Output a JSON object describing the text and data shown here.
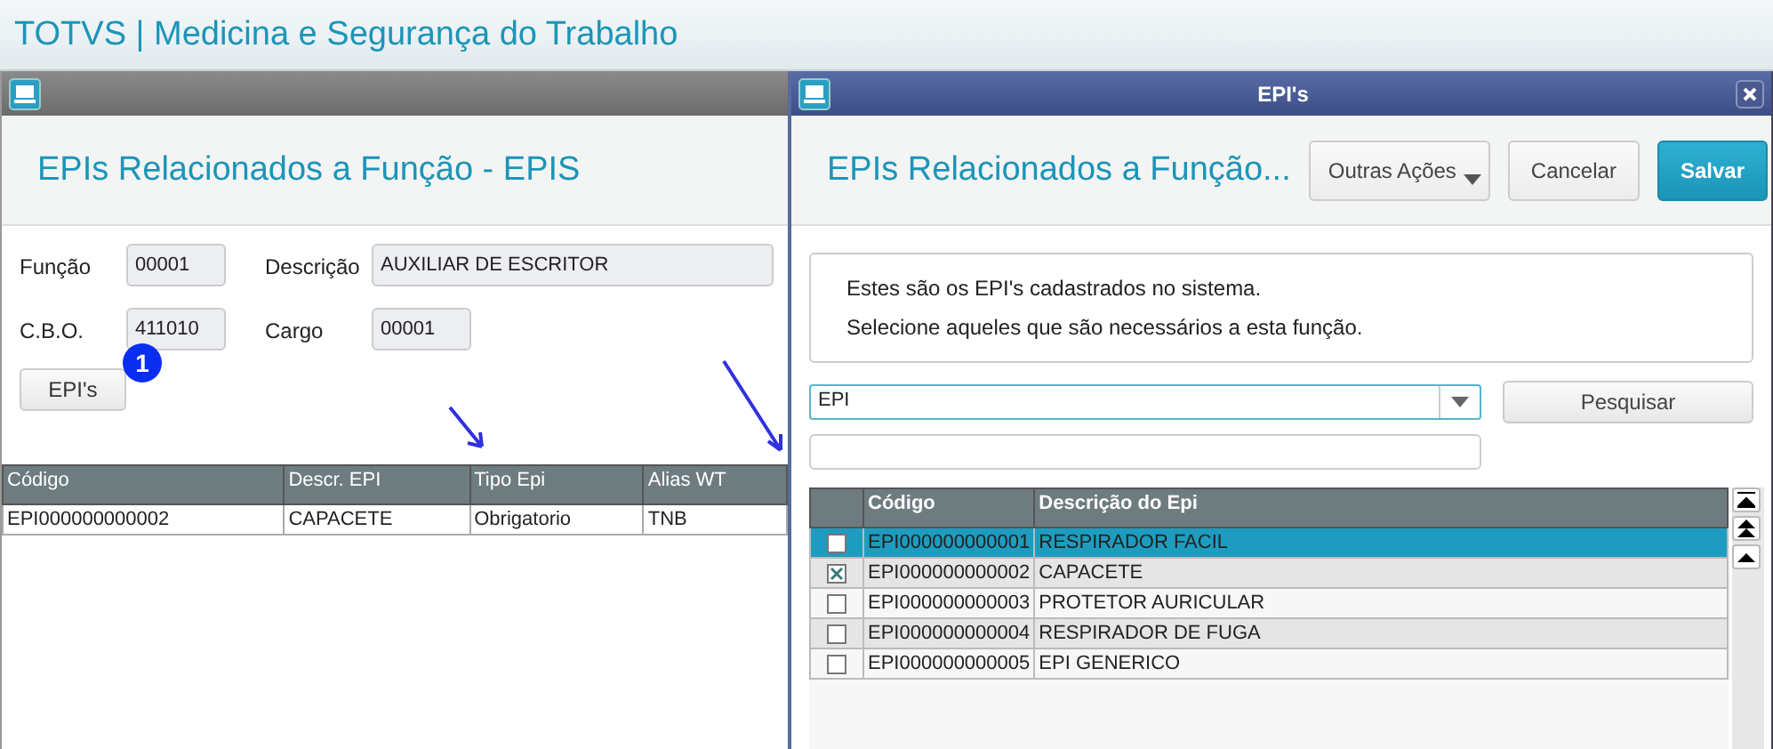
{
  "app_title": "TOTVS | Medicina e Segurança do Trabalho",
  "main_window": {
    "heading": "EPIs Relacionados a Função - EPIS",
    "fields": [
      {
        "label": "Função",
        "value": "00001"
      },
      {
        "label": "Descrição",
        "value": "AUXILIAR DE ESCRITOR"
      },
      {
        "label": "C.B.O.",
        "value": "411010"
      },
      {
        "label": "Cargo",
        "value": "00001"
      }
    ],
    "badge": "1",
    "button": "EPI's",
    "table": {
      "columns": [
        "Código",
        "Descr. EPI",
        "Tipo Epi",
        "Alias WT"
      ],
      "rows": [
        [
          "EPI000000000002",
          "CAPACETE",
          "Obrigatorio",
          "TNB"
        ]
      ]
    }
  },
  "dialog": {
    "title": "EPI's",
    "heading": "EPIs Relacionados a Função...",
    "buttons": [
      {
        "label": "Outras Ações",
        "kind": "menu"
      },
      {
        "label": "Cancelar",
        "kind": "plain"
      },
      {
        "label": "Salvar",
        "kind": "primary"
      }
    ],
    "info": [
      "Estes são os EPI's cadastrados no sistema.",
      "Selecione aqueles que são necessários a esta função."
    ],
    "search": {
      "value": "EPI",
      "button": "Pesquisar"
    },
    "table": {
      "columns": [
        "Código",
        "Descrição do Epi"
      ],
      "rows": [
        {
          "code": "EPI000000000001",
          "description": "RESPIRADOR FACIL",
          "checked": false,
          "selected": true
        },
        {
          "code": "EPI000000000002",
          "description": "CAPACETE",
          "checked": true,
          "selected": false
        },
        {
          "code": "EPI000000000003",
          "description": "PROTETOR AURICULAR",
          "checked": false,
          "selected": false
        },
        {
          "code": "EPI000000000004",
          "description": "RESPIRADOR DE FUGA",
          "checked": false,
          "selected": false
        },
        {
          "code": "EPI000000000005",
          "description": "EPI GENERICO",
          "checked": false,
          "selected": false
        }
      ]
    }
  }
}
